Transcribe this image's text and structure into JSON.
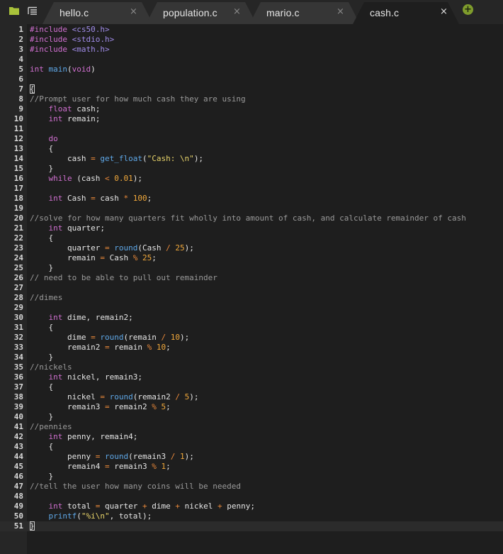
{
  "toolbar": {
    "folder_icon": "folder-icon",
    "list_icon": "list-icon",
    "add_tab_label": "+"
  },
  "tabs": [
    {
      "label": "hello.c",
      "close": "×",
      "active": false
    },
    {
      "label": "population.c",
      "close": "×",
      "active": false
    },
    {
      "label": "mario.c",
      "close": "×",
      "active": false
    },
    {
      "label": "cash.c",
      "close": "×",
      "active": true
    }
  ],
  "colors": {
    "background": "#1e1e1e",
    "gutter": "#262626",
    "accent_green": "#7f9c2c",
    "keyword": "#cf6fcf",
    "comment": "#9a9a9a",
    "string": "#e8d46a",
    "number": "#f2a93b",
    "operator": "#e8883a",
    "function": "#5fa8e8"
  },
  "editor": {
    "active_line": 51,
    "lines": [
      [
        [
          "pre",
          "#include "
        ],
        [
          "hdr",
          "<cs50.h>"
        ]
      ],
      [
        [
          "pre",
          "#include "
        ],
        [
          "hdr",
          "<stdio.h>"
        ]
      ],
      [
        [
          "pre",
          "#include "
        ],
        [
          "hdr",
          "<math.h>"
        ]
      ],
      [],
      [
        [
          "kw",
          "int "
        ],
        [
          "fn",
          "main"
        ],
        [
          "id",
          "("
        ],
        [
          "kw",
          "void"
        ],
        [
          "id",
          ")"
        ]
      ],
      [],
      [
        [
          "box",
          "{"
        ]
      ],
      [
        [
          "cm",
          "//Prompt user for how much cash they are using"
        ]
      ],
      [
        [
          "id",
          "    "
        ],
        [
          "kw",
          "float "
        ],
        [
          "id",
          "cash;"
        ]
      ],
      [
        [
          "id",
          "    "
        ],
        [
          "kw",
          "int "
        ],
        [
          "id",
          "remain;"
        ]
      ],
      [],
      [
        [
          "id",
          "    "
        ],
        [
          "kw",
          "do"
        ]
      ],
      [
        [
          "id",
          "    {"
        ]
      ],
      [
        [
          "id",
          "        cash "
        ],
        [
          "op",
          "="
        ],
        [
          "id",
          " "
        ],
        [
          "fn",
          "get_float"
        ],
        [
          "id",
          "("
        ],
        [
          "str",
          "\"Cash: \\n\""
        ],
        [
          "id",
          ");"
        ]
      ],
      [
        [
          "id",
          "    }"
        ]
      ],
      [
        [
          "id",
          "    "
        ],
        [
          "kw",
          "while"
        ],
        [
          "id",
          " (cash "
        ],
        [
          "op",
          "<"
        ],
        [
          "id",
          " "
        ],
        [
          "num",
          "0.01"
        ],
        [
          "id",
          ");"
        ]
      ],
      [],
      [
        [
          "id",
          "    "
        ],
        [
          "kw",
          "int "
        ],
        [
          "id",
          "Cash "
        ],
        [
          "op",
          "="
        ],
        [
          "id",
          " cash "
        ],
        [
          "op",
          "*"
        ],
        [
          "id",
          " "
        ],
        [
          "num",
          "100"
        ],
        [
          "id",
          ";"
        ]
      ],
      [],
      [
        [
          "cm",
          "//solve for how many quarters fit wholly into amount of cash, and calculate remainder of cash"
        ]
      ],
      [
        [
          "id",
          "    "
        ],
        [
          "kw",
          "int "
        ],
        [
          "id",
          "quarter;"
        ]
      ],
      [
        [
          "id",
          "    {"
        ]
      ],
      [
        [
          "id",
          "        quarter "
        ],
        [
          "op",
          "="
        ],
        [
          "id",
          " "
        ],
        [
          "fn",
          "round"
        ],
        [
          "id",
          "(Cash "
        ],
        [
          "op",
          "/"
        ],
        [
          "id",
          " "
        ],
        [
          "num",
          "25"
        ],
        [
          "id",
          ");"
        ]
      ],
      [
        [
          "id",
          "        remain "
        ],
        [
          "op",
          "="
        ],
        [
          "id",
          " Cash "
        ],
        [
          "op",
          "%"
        ],
        [
          "id",
          " "
        ],
        [
          "num",
          "25"
        ],
        [
          "id",
          ";"
        ]
      ],
      [
        [
          "id",
          "    }"
        ]
      ],
      [
        [
          "cm",
          "// need to be able to pull out remainder"
        ]
      ],
      [],
      [
        [
          "cm",
          "//dimes"
        ]
      ],
      [],
      [
        [
          "id",
          "    "
        ],
        [
          "kw",
          "int "
        ],
        [
          "id",
          "dime, remain2;"
        ]
      ],
      [
        [
          "id",
          "    {"
        ]
      ],
      [
        [
          "id",
          "        dime "
        ],
        [
          "op",
          "="
        ],
        [
          "id",
          " "
        ],
        [
          "fn",
          "round"
        ],
        [
          "id",
          "(remain "
        ],
        [
          "op",
          "/"
        ],
        [
          "id",
          " "
        ],
        [
          "num",
          "10"
        ],
        [
          "id",
          ");"
        ]
      ],
      [
        [
          "id",
          "        remain2 "
        ],
        [
          "op",
          "="
        ],
        [
          "id",
          " remain "
        ],
        [
          "op",
          "%"
        ],
        [
          "id",
          " "
        ],
        [
          "num",
          "10"
        ],
        [
          "id",
          ";"
        ]
      ],
      [
        [
          "id",
          "    }"
        ]
      ],
      [
        [
          "cm",
          "//nickels"
        ]
      ],
      [
        [
          "id",
          "    "
        ],
        [
          "kw",
          "int "
        ],
        [
          "id",
          "nickel, remain3;"
        ]
      ],
      [
        [
          "id",
          "    {"
        ]
      ],
      [
        [
          "id",
          "        nickel "
        ],
        [
          "op",
          "="
        ],
        [
          "id",
          " "
        ],
        [
          "fn",
          "round"
        ],
        [
          "id",
          "(remain2 "
        ],
        [
          "op",
          "/"
        ],
        [
          "id",
          " "
        ],
        [
          "num",
          "5"
        ],
        [
          "id",
          ");"
        ]
      ],
      [
        [
          "id",
          "        remain3 "
        ],
        [
          "op",
          "="
        ],
        [
          "id",
          " remain2 "
        ],
        [
          "op",
          "%"
        ],
        [
          "id",
          " "
        ],
        [
          "num",
          "5"
        ],
        [
          "id",
          ";"
        ]
      ],
      [
        [
          "id",
          "    }"
        ]
      ],
      [
        [
          "cm",
          "//pennies"
        ]
      ],
      [
        [
          "id",
          "    "
        ],
        [
          "kw",
          "int "
        ],
        [
          "id",
          "penny, remain4;"
        ]
      ],
      [
        [
          "id",
          "    {"
        ]
      ],
      [
        [
          "id",
          "        penny "
        ],
        [
          "op",
          "="
        ],
        [
          "id",
          " "
        ],
        [
          "fn",
          "round"
        ],
        [
          "id",
          "(remain3 "
        ],
        [
          "op",
          "/"
        ],
        [
          "id",
          " "
        ],
        [
          "num",
          "1"
        ],
        [
          "id",
          ");"
        ]
      ],
      [
        [
          "id",
          "        remain4 "
        ],
        [
          "op",
          "="
        ],
        [
          "id",
          " remain3 "
        ],
        [
          "op",
          "%"
        ],
        [
          "id",
          " "
        ],
        [
          "num",
          "1"
        ],
        [
          "id",
          ";"
        ]
      ],
      [
        [
          "id",
          "    }"
        ]
      ],
      [
        [
          "cm",
          "//tell the user how many coins will be needed"
        ]
      ],
      [],
      [
        [
          "id",
          "    "
        ],
        [
          "kw",
          "int "
        ],
        [
          "id",
          "total "
        ],
        [
          "op",
          "="
        ],
        [
          "id",
          " quarter "
        ],
        [
          "op",
          "+"
        ],
        [
          "id",
          " dime "
        ],
        [
          "op",
          "+"
        ],
        [
          "id",
          " nickel "
        ],
        [
          "op",
          "+"
        ],
        [
          "id",
          " penny;"
        ]
      ],
      [
        [
          "id",
          "    "
        ],
        [
          "fn",
          "printf"
        ],
        [
          "id",
          "("
        ],
        [
          "str",
          "\"%i\\n\""
        ],
        [
          "id",
          ", total);"
        ]
      ],
      [
        [
          "box",
          "}"
        ]
      ]
    ]
  }
}
